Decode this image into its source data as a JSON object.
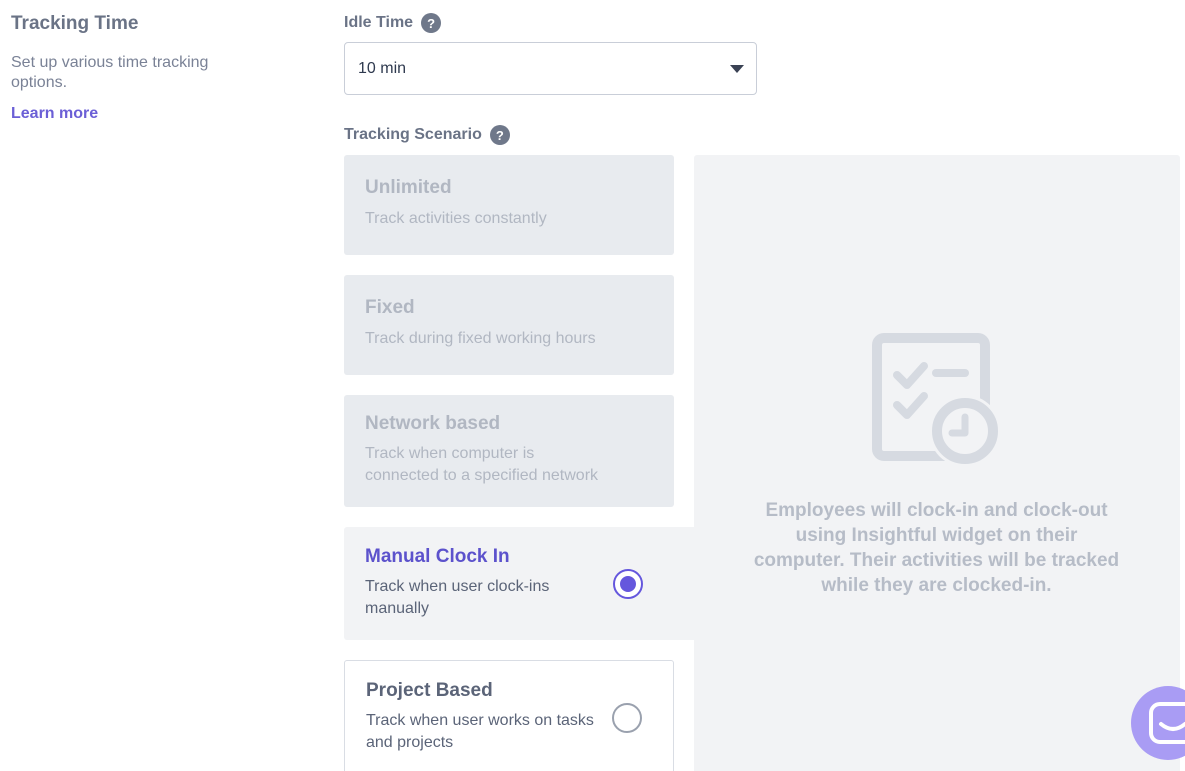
{
  "section": {
    "title": "Tracking Time",
    "description": "Set up various time tracking options.",
    "learn_more": "Learn more"
  },
  "idle_time": {
    "label": "Idle Time",
    "help": "?",
    "selected_value": "10 min"
  },
  "tracking_scenario": {
    "label": "Tracking Scenario",
    "help": "?",
    "options": [
      {
        "title": "Unlimited",
        "description": "Track activities constantly",
        "state": "disabled"
      },
      {
        "title": "Fixed",
        "description": "Track during fixed working hours",
        "state": "disabled"
      },
      {
        "title": "Network based",
        "description": "Track when computer is connected to a specified network",
        "state": "disabled"
      },
      {
        "title": "Manual Clock In",
        "description": "Track when user clock-ins manually",
        "state": "selected"
      },
      {
        "title": "Project Based",
        "description": "Track when user works on tasks and projects",
        "state": "unselected"
      }
    ]
  },
  "preview": {
    "icon": "checklist-clock-icon",
    "text": "Employees will clock-in and clock-out using Insightful widget on their computer. Their activities will be tracked while they are clocked-in."
  },
  "chat": {
    "icon": "chat-smile-icon"
  },
  "colors": {
    "accent": "#6557dd",
    "accent_text": "#5c52cc",
    "link": "#6b5fd6",
    "disabled_bg": "#e8ebef",
    "panel_bg": "#f2f3f5",
    "chat_bubble": "#a99cf4"
  }
}
